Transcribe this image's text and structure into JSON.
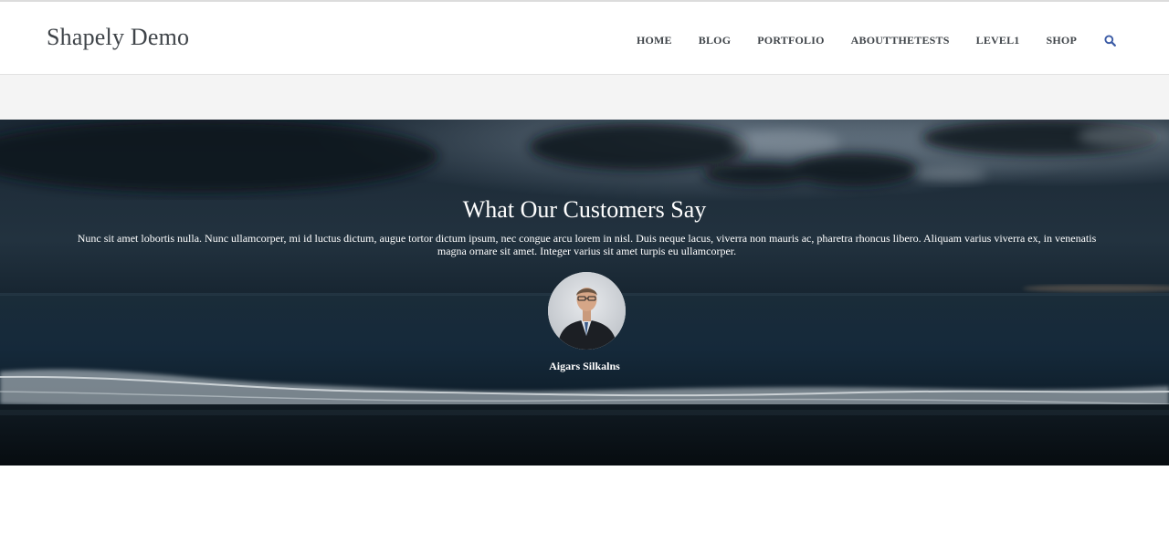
{
  "site": {
    "brand": "Shapely Demo"
  },
  "nav": {
    "items": [
      "HOME",
      "BLOG",
      "PORTFOLIO",
      "ABOUTTHETESTS",
      "LEVEL1",
      "SHOP"
    ],
    "search_icon": "search-icon",
    "search_color": "#3b5ba5"
  },
  "testimonial": {
    "title": "What Our Customers Say",
    "quote": "Nunc sit amet lobortis nulla. Nunc ullamcorper, mi id luctus dictum, augue tortor dictum ipsum, nec congue arcu lorem in nisl. Duis neque lacus, viverra non mauris ac, pharetra rhoncus libero. Aliquam varius viverra ex, in venenatis magna ornare sit amet. Integer varius sit amet turpis eu ullamcorper.",
    "author": "Aigars Silkalns"
  }
}
